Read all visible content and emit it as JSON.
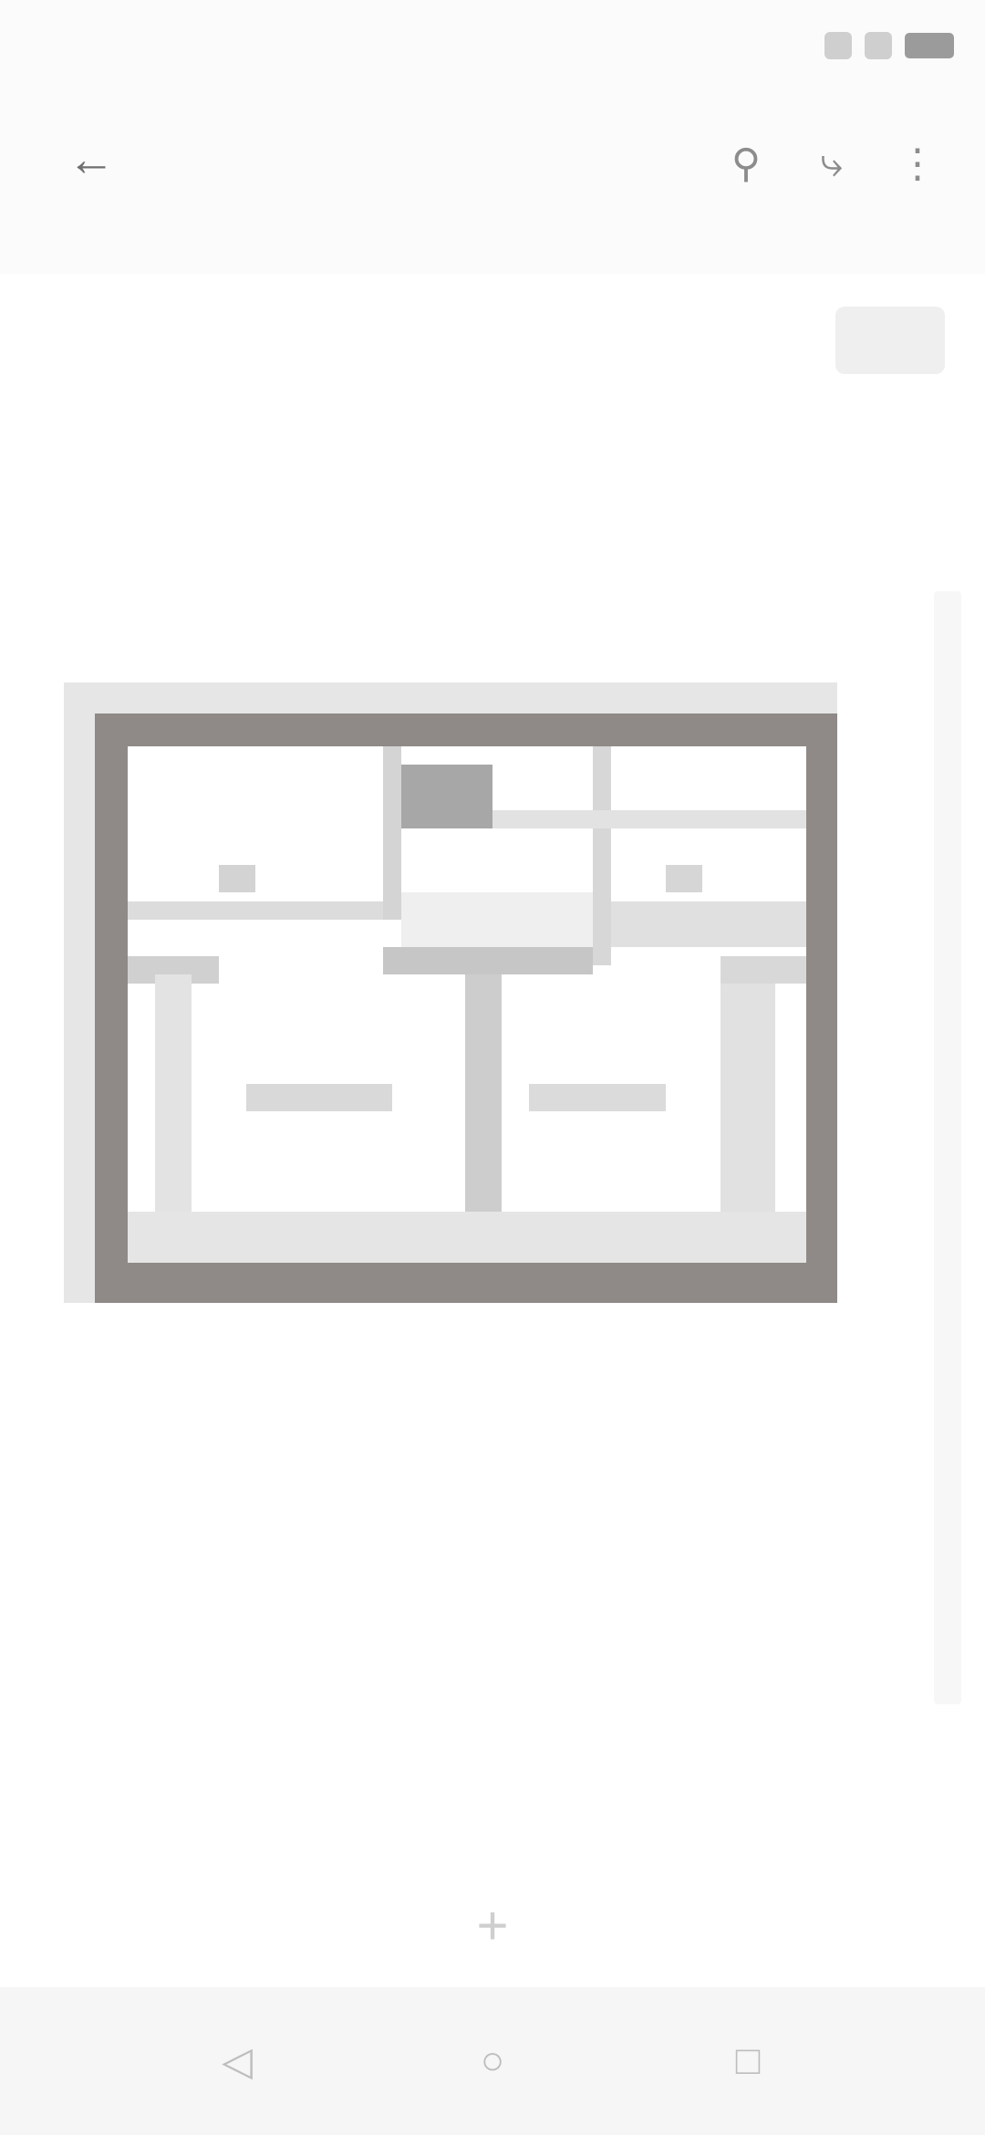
{
  "status_bar": {
    "time": "",
    "icons": [
      "signal-icon",
      "wifi-icon",
      "battery-icon"
    ]
  },
  "app_bar": {
    "title": "",
    "actions": [
      "search-icon",
      "share-icon",
      "more-icon"
    ]
  },
  "pill_button": {
    "label": ""
  },
  "floor_plan": {
    "label_left": "",
    "label_right": "",
    "colors": {
      "wall": "#8f8a87",
      "inner": "#d9d9d9",
      "room": "#ffffff"
    }
  },
  "caption": {
    "text": ""
  },
  "center_action": {
    "icon": "add-icon"
  },
  "nav_bar": {
    "items": [
      "back-icon",
      "home-icon",
      "recents-icon"
    ]
  }
}
